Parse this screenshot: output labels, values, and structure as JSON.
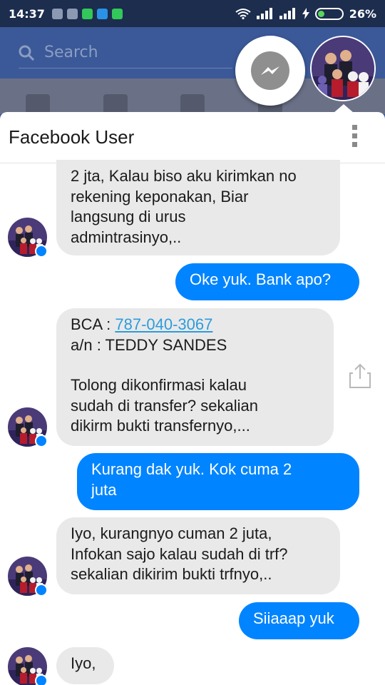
{
  "status_bar": {
    "time": "14:37",
    "battery": "26%",
    "battery_fraction": 0.26
  },
  "search": {
    "placeholder": "Search"
  },
  "colors": {
    "facebook_blue": "#3b5998",
    "messenger_blue": "#0084ff",
    "incoming_bubble": "#e9e9ea"
  },
  "icons": [
    "search-icon",
    "messenger-icon",
    "more-options-icon",
    "share-icon",
    "messenger-badge-icon"
  ],
  "chat": {
    "title": "Facebook User",
    "messages": [
      {
        "side": "in",
        "text": "2 jta, Kalau biso aku kirimkan no\nrekening keponakan, Biar\nlangsung di urus\nadmintrasinyo,.."
      },
      {
        "side": "out",
        "text": "Oke yuk. Bank apo?"
      },
      {
        "side": "in",
        "bank_label": "BCA : ",
        "account_number": "787-040-3067",
        "holder": "a/n : TEDDY SANDES",
        "text": "Tolong dikonfirmasi kalau\nsudah di transfer? sekalian\ndikirm bukti transfernyo,..."
      },
      {
        "side": "out",
        "text": "Kurang dak yuk. Kok cuma 2\njuta"
      },
      {
        "side": "in",
        "text": "Iyo, kurangnyo cuman 2 juta,\nInfokan sajo kalau sudah di trf?\nsekalian dikirim bukti trfnyo,.."
      },
      {
        "side": "out",
        "text": "Siiaaap yuk"
      },
      {
        "side": "in",
        "text": "Iyo,"
      }
    ]
  }
}
